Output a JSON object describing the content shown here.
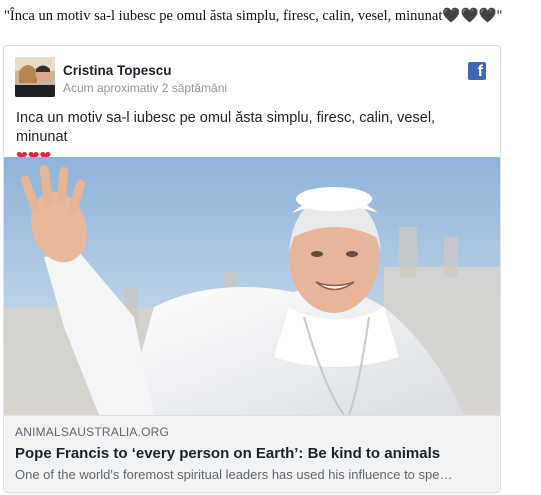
{
  "caption": "\"Înca un motiv sa-l iubesc pe omul ăsta simplu, firesc, calin, vesel, minunat🖤🖤🖤\"",
  "post": {
    "author_name": "Cristina Topescu",
    "time": "Acum aproximativ 2 săptămâni",
    "text": "Inca un motiv sa-l iubesc pe omul ăsta simplu, firesc, calin, vesel, minunat",
    "hearts": "❤❤❤",
    "fb_icon": "facebook-icon"
  },
  "link": {
    "domain": "ANIMALSAUSTRALIA.ORG",
    "title": "Pope Francis to ‘every person on Earth’: Be kind to animals",
    "description": "One of the world's foremost spiritual leaders has used his influence to spe…"
  },
  "colors": {
    "facebook_blue": "#4267b2",
    "heart_red": "#e0253a",
    "meta_bg": "#f2f3f5"
  }
}
